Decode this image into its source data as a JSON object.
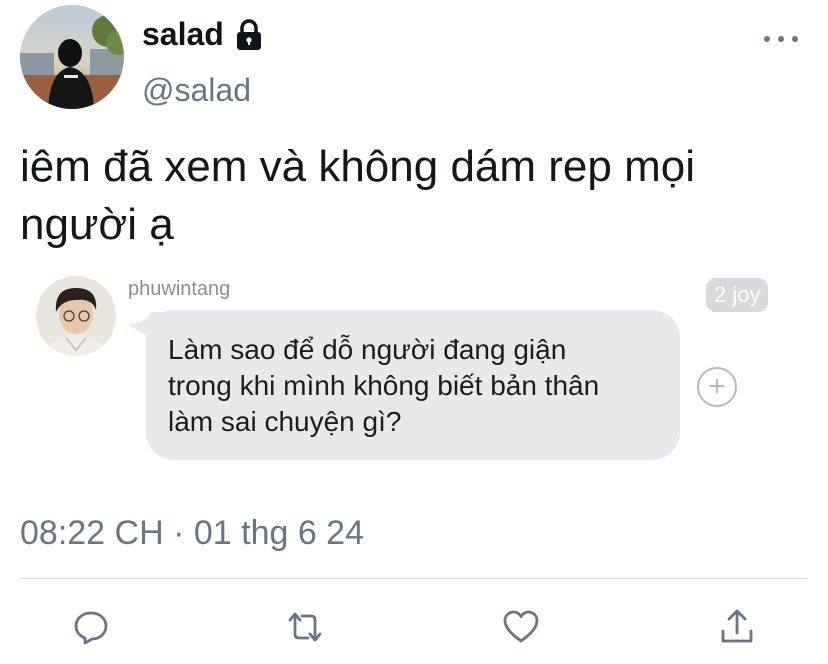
{
  "user": {
    "display_name": "salad",
    "handle": "@salad",
    "protected_icon": "lock-icon",
    "avatar": "profile-photo"
  },
  "tweet": {
    "text": "iêm đã xem và không dám rep mọi người ạ",
    "timestamp": "08:22 CH · 01 thg 6 24"
  },
  "embedded_message": {
    "sender": "phuwintang",
    "time_badge": "2 joy",
    "lines": [
      "Làm sao để dỗ người đang giận",
      "trong khi mình không biết bản thân",
      "làm sai chuyện gì?"
    ],
    "add_icon": "plus-circle-icon"
  },
  "actions": [
    {
      "icon": "reply-icon"
    },
    {
      "icon": "retweet-icon"
    },
    {
      "icon": "like-icon"
    },
    {
      "icon": "share-icon"
    }
  ],
  "colors": {
    "secondary_text": "#687684",
    "bubble_bg": "#e9e9eb",
    "divider": "#d4dce2"
  }
}
